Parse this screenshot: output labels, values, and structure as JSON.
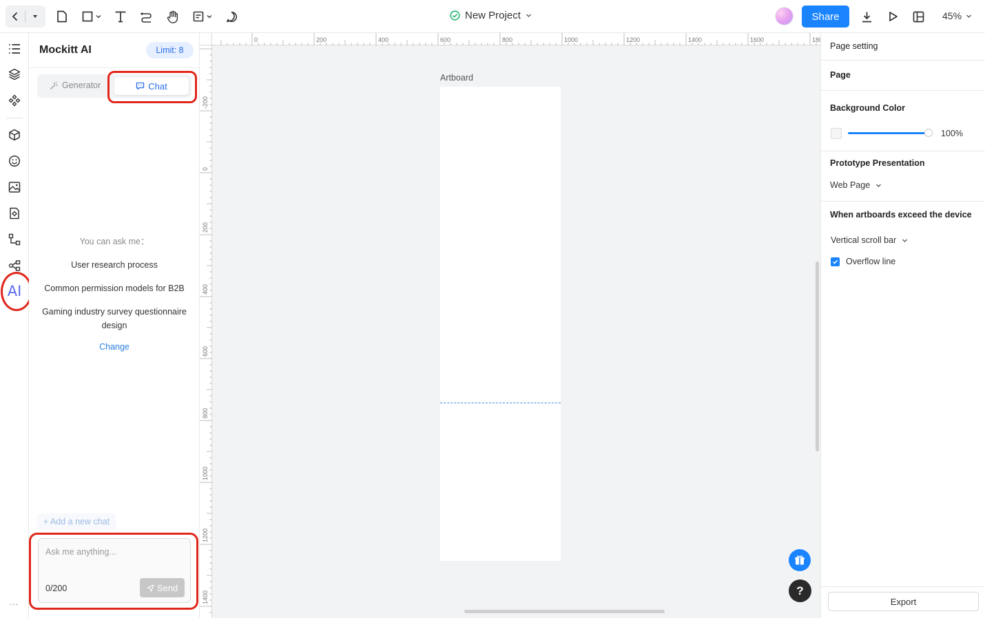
{
  "topbar": {
    "project_name": "New Project",
    "share_label": "Share",
    "zoom": "45%"
  },
  "ai_panel": {
    "title": "Mockitt AI",
    "limit": "Limit: 8",
    "tabs": [
      {
        "label": "Generator",
        "active": false
      },
      {
        "label": "Chat",
        "active": true
      }
    ],
    "intro": "You can ask me：",
    "suggestions": [
      "User research process",
      "Common permission models for B2B",
      "Gaming industry survey questionnaire design"
    ],
    "change_label": "Change",
    "add_chat_label": "+ Add a new chat",
    "input_placeholder": "Ask me anything...",
    "counter": "0/200",
    "send_label": "Send"
  },
  "rail": {
    "ai_label": "AI",
    "more": "..."
  },
  "canvas": {
    "ruler_top": [
      "0",
      "200",
      "400",
      "600",
      "800",
      "1000",
      "1200",
      "1400",
      "1600",
      "180"
    ],
    "ruler_left": [
      "-200",
      "0",
      "200",
      "400",
      "600",
      "800",
      "1000",
      "1200",
      "1400"
    ],
    "artboard_label": "Artboard"
  },
  "settings": {
    "header": "Page setting",
    "page_label": "Page",
    "background_color_label": "Background Color",
    "opacity": "100%",
    "prototype_label": "Prototype Presentation",
    "prototype_value": "Web Page",
    "exceed_label": "When artboards exceed the device",
    "exceed_value": "Vertical scroll bar",
    "overflow_label": "Overflow line",
    "overflow_checked": true,
    "export_label": "Export"
  },
  "colors": {
    "accent": "#1a84ff",
    "highlight_ring": "#e0261b",
    "ai_purple": "#5b6cf0"
  }
}
